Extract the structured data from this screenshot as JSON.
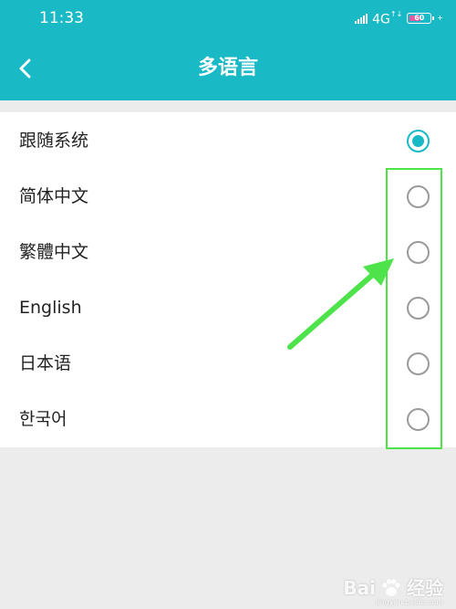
{
  "status_bar": {
    "time": "11:33",
    "network": "4G",
    "network_sup": "↑↓",
    "battery": "60",
    "battery_level": 0.6
  },
  "header": {
    "title": "多语言",
    "back_icon": "chevron-left-icon"
  },
  "languages": [
    {
      "label": "跟随系统",
      "selected": true
    },
    {
      "label": "简体中文",
      "selected": false
    },
    {
      "label": "繁體中文",
      "selected": false
    },
    {
      "label": "English",
      "selected": false
    },
    {
      "label": "日本语",
      "selected": false
    },
    {
      "label": "한국어",
      "selected": false
    }
  ],
  "watermark": {
    "brand": "Bai",
    "brand_tail": "经验",
    "url": "jingyan.baidu.com"
  },
  "colors": {
    "accent": "#19b9c6",
    "annotation": "#4ee34b",
    "background": "#ececec"
  }
}
